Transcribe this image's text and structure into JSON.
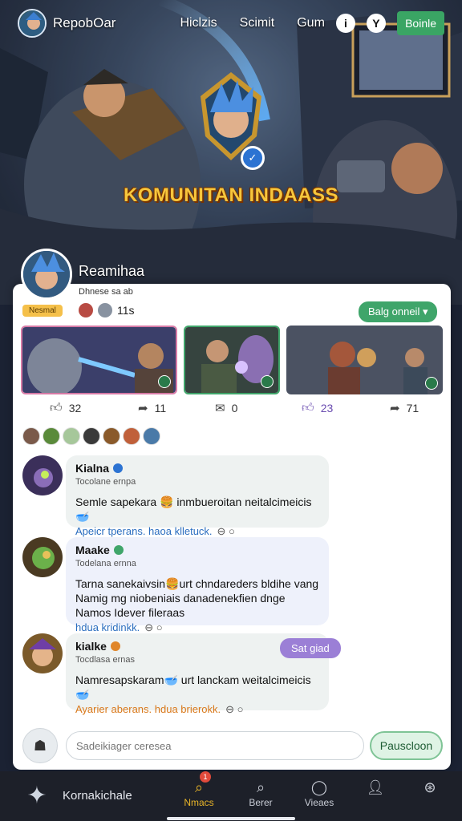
{
  "header": {
    "brand": "RepobOar",
    "nav": [
      "Hiclzis",
      "Scimit",
      "Gum"
    ],
    "icon1": "i",
    "icon2": "Y",
    "action": "Boinle"
  },
  "hero": {
    "title": "KOMUNITAN INDAASS"
  },
  "profile": {
    "name": "Reamihaa",
    "subtitle": "Dhnese sa ab",
    "badge": "Nesmal",
    "count": "11s",
    "dropdown": "Balg onneil"
  },
  "stats": [
    {
      "icon": "like-icon",
      "value": "32"
    },
    {
      "icon": "share-icon",
      "value": "11"
    },
    {
      "icon": "message-icon",
      "value": "0"
    },
    {
      "icon": "like-icon",
      "value": "23",
      "highlight": true
    },
    {
      "icon": "share-icon",
      "value": "71"
    }
  ],
  "comments": [
    {
      "name": "Kialna",
      "subtitle": "Tocolane ernpa",
      "text": "Semle sapekara 🍔 inmbueroitan neitalcimeicis 🥣",
      "link": "Apeicr tperans. haoa klletuck.",
      "tag": "⊖ ○",
      "dot": "#2c73d2"
    },
    {
      "name": "Maake",
      "subtitle": "Todelana ernna",
      "text": "Tarna sanekaivsin🍔urt chndareders bldihe vang Namig mg niobeniais danadenekfien dnge Namos Idever fileraas",
      "link": "hdua kridinkk.",
      "tag": "⊖ ○",
      "dot": "#3fa56a"
    },
    {
      "name": "kialke",
      "subtitle": "Tocdlasa ernas",
      "text": "Namresapskaram🥣 urt lanckam weitalcimeicis 🥣",
      "link": "Ayarier aberans. hdua brierokk.",
      "tag": "⊖ ○",
      "dot": "#e0862a",
      "button": "Sat giad"
    }
  ],
  "composer": {
    "placeholder": "Sadeikiager ceresea",
    "button": "Pauscloon"
  },
  "bottombar": {
    "title": "Kornakichale",
    "items": [
      {
        "label": "Nmacs",
        "icon": "search-icon",
        "active": true,
        "badge": "1"
      },
      {
        "label": "Berer",
        "icon": "search-icon"
      },
      {
        "label": "Vieaes",
        "icon": "chat-icon"
      },
      {
        "label": "",
        "icon": "profile-icon"
      },
      {
        "label": "",
        "icon": "compass-icon"
      }
    ]
  },
  "colors": {
    "accent": "#3aa564",
    "highlight": "#6a4cb0",
    "title": "#f7c63c",
    "bar": "#1d2029"
  }
}
